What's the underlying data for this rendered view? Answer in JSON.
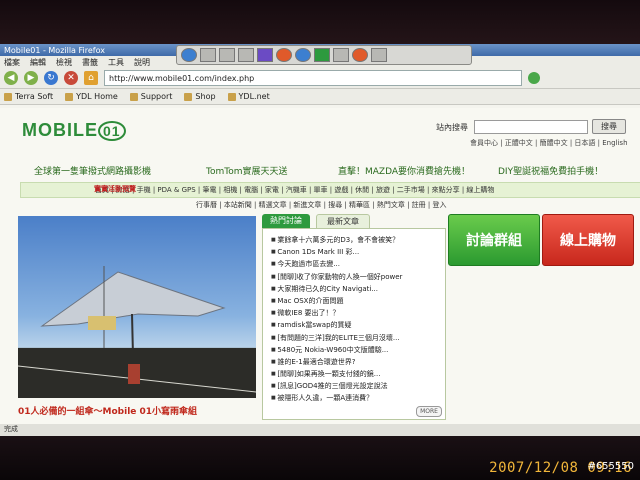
{
  "window": {
    "title": "Mobile01 - Mozilla Firefox",
    "menu": [
      "檔案",
      "編輯",
      "檢視",
      "書籤",
      "工具",
      "說明"
    ],
    "url": "http://www.mobile01.com/index.php"
  },
  "bookmarks": [
    "Terra Soft",
    "YDL Home",
    "Support",
    "Shop",
    "YDL.net"
  ],
  "site": {
    "logo_text": "MOBILE",
    "logo_num": "01",
    "search_label": "站內搜尋",
    "search_button": "搜尋",
    "toplinks": "會員中心 | 正體中文 | 簡體中文 | 日本語 | English",
    "promos": [
      "全球第一隻筆撥式網路攝影機",
      "TomTom實展天天送",
      "直擊！MAZDA要你消費搶先機！",
      "DIY聖誕祝福免費拍手機！"
    ],
    "cat_highlight": "實實活動預覽",
    "categories": "首頁 | 房話 | 手機 | PDA & GPS | 筆電 | 相機 | 電腦 | 家電 | 汽機車 | 單車 | 遊戲 | 休閒 | 旅遊 | 二手市場 | 來點分享 | 線上購物",
    "subnav": "行事曆 | 本站新聞 | 精選文章 | 新進文章 | 搜尋 | 精華區 | 熱門文章 | 註冊 | 登入",
    "caption": "01人必備的一組傘～Mobile 01小寫雨傘組",
    "tabs": [
      "熱門討論",
      "最新文章"
    ],
    "news": [
      "業餘拿十六萬多元的D3，會不會被笑？",
      "Canon 1Ds Mark III 彩...",
      "今天跑過市區去變...",
      "[閒聊]收了你家動物的人換一個好power",
      "大家期待已久的City Navigati...",
      "Mac OSX的介面問題",
      "微軟IE8 要出了！？",
      "ramdisk當swap的質疑",
      "[有問題的三洋]我的ELITE三個月沒壞...",
      "5480元 Nokia-W960中文版體驗...",
      "誰的E-1最適合環遊世界?",
      "[閒聊]如果再換一顆支付錢的鏡...",
      "[訊息]GOD4推的三個燈光設定說法",
      "被隱形人久違，一顆A連消費？"
    ],
    "more": "MORE",
    "btn_forum": "討論群組",
    "btn_shop": "線上購物"
  },
  "status": "完成",
  "stamp": "2007/12/08 09:16",
  "photo_id": "#655550"
}
